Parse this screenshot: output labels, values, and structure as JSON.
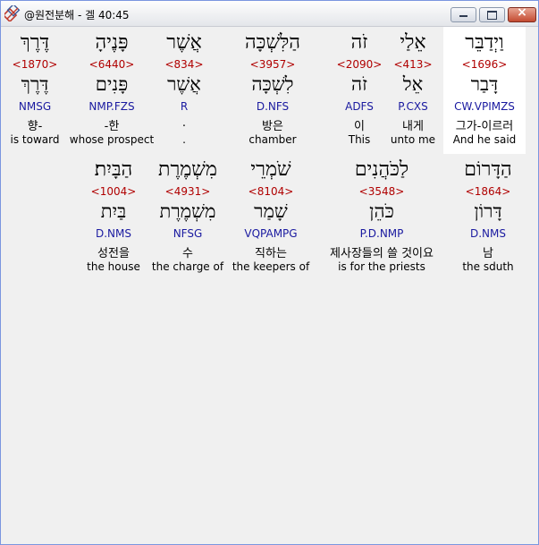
{
  "window": {
    "title": "@원전분해 - 겔 40:45"
  },
  "row1": [
    {
      "heb": "וַיְדַבֵּר",
      "strong": "<1696>",
      "lemma": "דָּבַר",
      "morph": "CW.VPIMZS",
      "kor": "그가-이르러",
      "eng": "And he said"
    },
    {
      "heb": "אֵלַי",
      "strong": "<413>",
      "lemma": "אֵל",
      "morph": "P.CXS",
      "kor": "내게",
      "eng": "unto me"
    },
    {
      "heb": "זֹה",
      "strong": "<2090>",
      "lemma": "זֹה",
      "morph": "ADFS",
      "kor": "이",
      "eng": "This"
    },
    {
      "heb": "הַלִּשְׁכָּה",
      "strong": "<3957>",
      "lemma": "לִשְׁכָּה",
      "morph": "D.NFS",
      "kor": "방은",
      "eng": "chamber"
    },
    {
      "heb": "אֲשֶׁר",
      "strong": "<834>",
      "lemma": "אֲשֶׁר",
      "morph": "R",
      "kor": ".",
      "eng": "."
    },
    {
      "heb": "פָּנֶיהָ",
      "strong": "<6440>",
      "lemma": "פָּנִים",
      "morph": "NMP.FZS",
      "kor": "-한",
      "eng": "whose prospect"
    },
    {
      "heb": "דֶּרֶךְ",
      "strong": "<1870>",
      "lemma": "דֶּרֶךְ",
      "morph": "NMSG",
      "kor": "향-",
      "eng": "is toward"
    }
  ],
  "row2": [
    {
      "heb": "הַדָּרוֹם",
      "strong": "<1864>",
      "lemma": "דָּרוֹן",
      "morph": "D.NMS",
      "kor": "남",
      "eng": "the sduth"
    },
    {
      "heb": "לַכֹּהֲנִים",
      "strong": "<3548>",
      "lemma": "כֹּהֵן",
      "morph": "P.D.NMP",
      "kor": "제사장들의 쓸 것이요",
      "eng": "is for the priests"
    },
    {
      "heb": "שֹׁמְרֵי",
      "strong": "<8104>",
      "lemma": "שָׁמַר",
      "morph": "VQPAMPG",
      "kor": "직하는",
      "eng": "the keepers of"
    },
    {
      "heb": "מִשְׁמֶרֶת",
      "strong": "<4931>",
      "lemma": "מִשְׁמֶרֶת",
      "morph": "NFSG",
      "kor": "수",
      "eng": "the charge of"
    },
    {
      "heb": "הַבָּיִת׃",
      "strong": "<1004>",
      "lemma": "בַּיִת",
      "morph": "D.NMS",
      "kor": "성전을",
      "eng": "the house"
    }
  ]
}
